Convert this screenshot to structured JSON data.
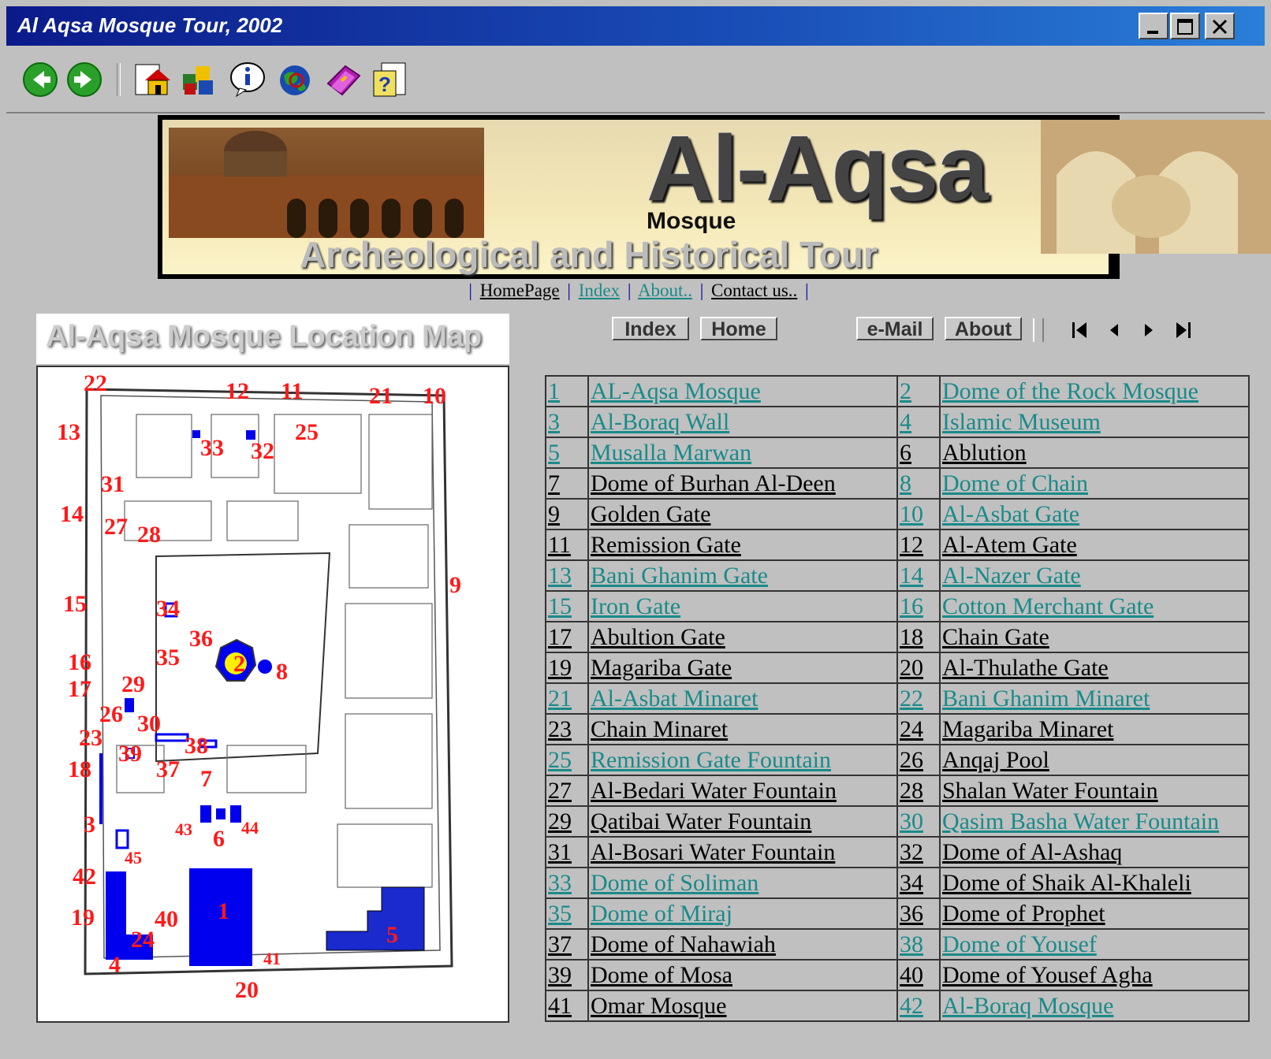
{
  "window": {
    "title": "Al Aqsa Mosque Tour, 2002"
  },
  "toolbar": {
    "buttons": [
      {
        "name": "back-icon"
      },
      {
        "name": "forward-icon"
      },
      {
        "name": "home-icon"
      },
      {
        "name": "puzzle-icon"
      },
      {
        "name": "info-icon"
      },
      {
        "name": "globe-icon"
      },
      {
        "name": "book-icon"
      },
      {
        "name": "question-icon"
      }
    ]
  },
  "banner": {
    "logo": "Al-Aqsa",
    "sub1": "Mosque",
    "sub2": "Archeological and Historical Tour"
  },
  "nav": {
    "homepage": "HomePage",
    "index": "Index",
    "about": "About..",
    "contact": "Contact us..",
    "sep": "|"
  },
  "map": {
    "title": "Al-Aqsa Mosque Location Map",
    "labels": [
      "1",
      "2",
      "3",
      "4",
      "5",
      "6",
      "7",
      "8",
      "9",
      "10",
      "11",
      "12",
      "13",
      "14",
      "15",
      "16",
      "17",
      "18",
      "19",
      "20",
      "21",
      "22",
      "23",
      "24",
      "25",
      "26",
      "27",
      "28",
      "29",
      "30",
      "31",
      "32",
      "33",
      "34",
      "35",
      "36",
      "37",
      "38",
      "39",
      "40",
      "41",
      "42",
      "43",
      "44",
      "45"
    ]
  },
  "buttons": {
    "index": "Index",
    "home": "Home",
    "email": "e-Mail",
    "about": "About"
  },
  "table": {
    "rows": [
      [
        {
          "n": "1",
          "t": "AL-Aqsa Mosque",
          "teal": true
        },
        {
          "n": "2",
          "t": "Dome of the Rock Mosque",
          "teal": true
        }
      ],
      [
        {
          "n": "3",
          "t": "Al-Boraq Wall",
          "teal": true
        },
        {
          "n": "4",
          "t": "Islamic Museum",
          "teal": true
        }
      ],
      [
        {
          "n": "5",
          "t": "Musalla Marwan",
          "teal": true
        },
        {
          "n": "6",
          "t": "Ablution",
          "teal": false
        }
      ],
      [
        {
          "n": "7",
          "t": "Dome of Burhan Al-Deen",
          "teal": false
        },
        {
          "n": "8",
          "t": "Dome of Chain",
          "teal": true
        }
      ],
      [
        {
          "n": "9",
          "t": "Golden Gate",
          "teal": false
        },
        {
          "n": "10",
          "t": "Al-Asbat Gate",
          "teal": true
        }
      ],
      [
        {
          "n": "11",
          "t": "Remission Gate",
          "teal": false
        },
        {
          "n": "12",
          "t": "Al-Atem Gate",
          "teal": false
        }
      ],
      [
        {
          "n": "13",
          "t": "Bani Ghanim Gate",
          "teal": true
        },
        {
          "n": "14",
          "t": "Al-Nazer Gate",
          "teal": true
        }
      ],
      [
        {
          "n": "15",
          "t": "Iron Gate",
          "teal": true
        },
        {
          "n": "16",
          "t": "Cotton Merchant Gate",
          "teal": true
        }
      ],
      [
        {
          "n": "17",
          "t": "Abultion Gate",
          "teal": false
        },
        {
          "n": "18",
          "t": "Chain Gate",
          "teal": false
        }
      ],
      [
        {
          "n": "19",
          "t": "Magariba Gate",
          "teal": false
        },
        {
          "n": "20",
          "t": "Al-Thulathe Gate",
          "teal": false
        }
      ],
      [
        {
          "n": "21",
          "t": "Al-Asbat Minaret",
          "teal": true
        },
        {
          "n": "22",
          "t": "Bani Ghanim Minaret",
          "teal": true
        }
      ],
      [
        {
          "n": "23",
          "t": "Chain Minaret",
          "teal": false
        },
        {
          "n": "24",
          "t": "Magariba Minaret",
          "teal": false
        }
      ],
      [
        {
          "n": "25",
          "t": "Remission Gate Fountain",
          "teal": true
        },
        {
          "n": "26",
          "t": "Anqaj Pool",
          "teal": false
        }
      ],
      [
        {
          "n": "27",
          "t": "Al-Bedari Water Fountain",
          "teal": false
        },
        {
          "n": "28",
          "t": "Shalan Water Fountain",
          "teal": false
        }
      ],
      [
        {
          "n": "29",
          "t": "Qatibai Water Fountain",
          "teal": false
        },
        {
          "n": "30",
          "t": "Qasim Basha Water Fountain",
          "teal": true
        }
      ],
      [
        {
          "n": "31",
          "t": "Al-Bosari Water Fountain",
          "teal": false
        },
        {
          "n": "32",
          "t": "Dome of Al-Ashaq",
          "teal": false
        }
      ],
      [
        {
          "n": "33",
          "t": "Dome of Soliman",
          "teal": true
        },
        {
          "n": "34",
          "t": "Dome of Shaik Al-Khaleli",
          "teal": false
        }
      ],
      [
        {
          "n": "35",
          "t": "Dome of Miraj",
          "teal": true
        },
        {
          "n": "36",
          "t": "Dome of Prophet",
          "teal": false
        }
      ],
      [
        {
          "n": "37",
          "t": "Dome of Nahawiah",
          "teal": false
        },
        {
          "n": "38",
          "t": "Dome of Yousef",
          "teal": true
        }
      ],
      [
        {
          "n": "39",
          "t": "Dome of Mosa",
          "teal": false
        },
        {
          "n": "40",
          "t": "Dome of Yousef Agha",
          "teal": false
        }
      ],
      [
        {
          "n": "41",
          "t": "Omar Mosque",
          "teal": false
        },
        {
          "n": "42",
          "t": "Al-Boraq Mosque",
          "teal": true
        }
      ]
    ]
  }
}
